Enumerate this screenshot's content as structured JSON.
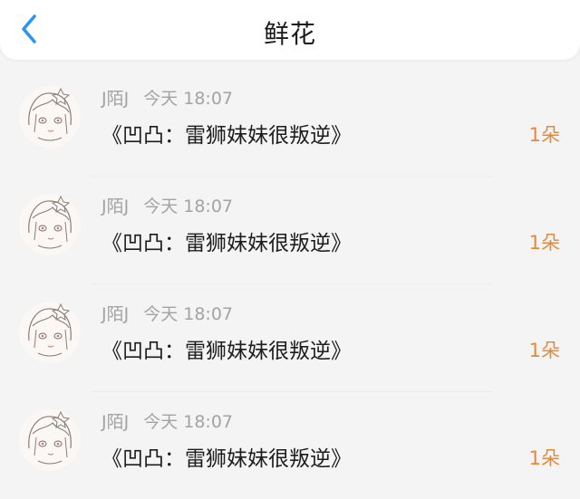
{
  "header": {
    "title": "鲜花",
    "back_icon": "chevron-left-icon",
    "accent_color": "#2a93f5"
  },
  "items": [
    {
      "user": "J陌J",
      "time": "今天 18:07",
      "book": "《凹凸：雷狮妹妹很叛逆》",
      "count": "1朵"
    },
    {
      "user": "J陌J",
      "time": "今天 18:07",
      "book": "《凹凸：雷狮妹妹很叛逆》",
      "count": "1朵"
    },
    {
      "user": "J陌J",
      "time": "今天 18:07",
      "book": "《凹凸：雷狮妹妹很叛逆》",
      "count": "1朵"
    },
    {
      "user": "J陌J",
      "time": "今天 18:07",
      "book": "《凹凸：雷狮妹妹很叛逆》",
      "count": "1朵"
    }
  ],
  "colors": {
    "count": "#e58a3c",
    "meta": "#a3a3a3"
  }
}
